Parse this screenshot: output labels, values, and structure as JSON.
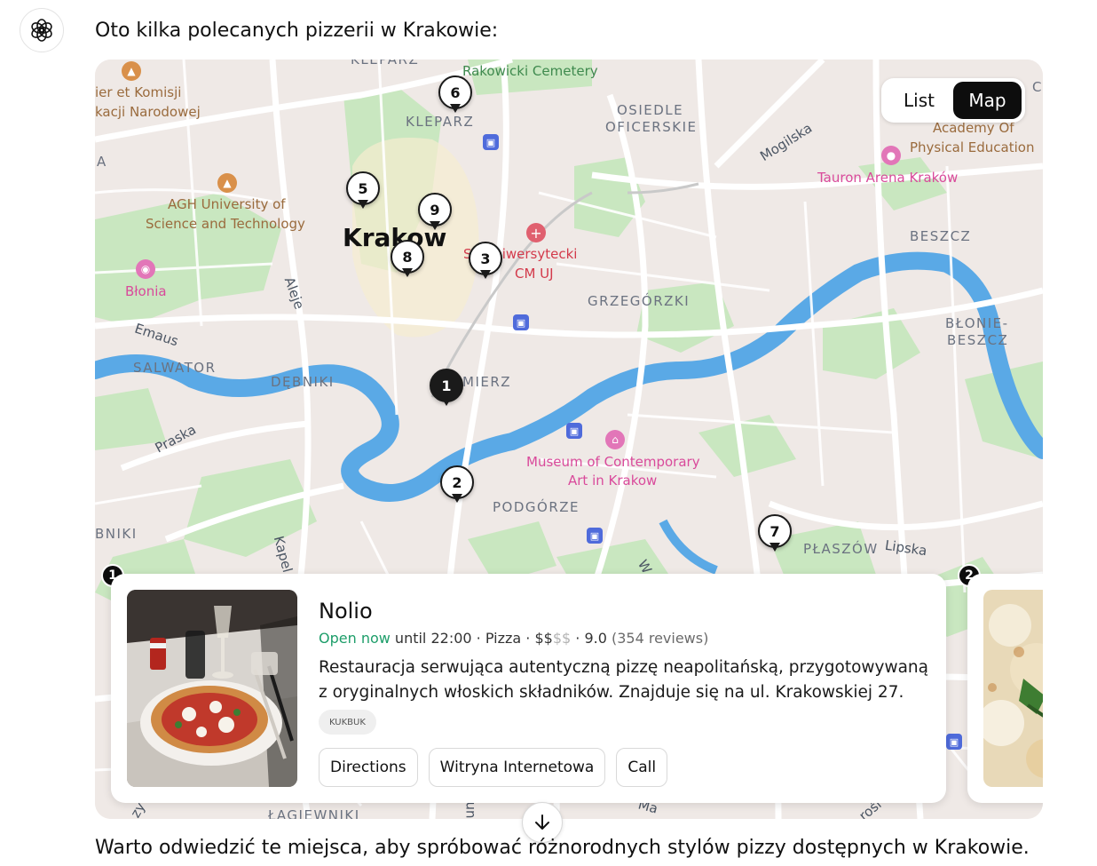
{
  "intro_text": "Oto kilka polecanych pizzerii w Krakowie:",
  "outro_text": "Warto odwiedzić te miejsca, aby spróbować różnorodnych stylów pizzy dostępnych w Krakowie.",
  "view_toggle": {
    "list_label": "List",
    "map_label": "Map",
    "selected": "Map"
  },
  "map": {
    "labels": {
      "kleparz_top": "KLEPARZ",
      "rakowicki": "Rakowicki Cemetery",
      "komisji": "ier  et Komisji",
      "narodowej": "kacji Narodowej",
      "kleparz": "KLEPARZ",
      "osiedle": "OSIEDLE",
      "oficerskie": "OFICERSKIE",
      "mogilska": "Mogilska",
      "academy1": "Academy Of",
      "academy2": "Physical Education",
      "tauron": "Tauron Arena Kraków",
      "agh1": "AGH University of",
      "agh2": "Science and Technology",
      "city": "Krakow",
      "szpital": "S    l Uniwersytecki",
      "cmuj": "CM UJ",
      "beszcz": "BESZCZ",
      "blonia": "Błonia",
      "aleje": "Aleje",
      "grzegorzki": "GRZEGÓRZKI",
      "emaus": "Emaus",
      "bl1": "BŁONIE-",
      "bl2": "BESZCZ",
      "salwator": "SALWATOR",
      "debniki": "DĘBNIKI",
      "kazimierz": "MIERZ",
      "praska": "Praska",
      "museum1": "Museum of Contemporary",
      "museum2": "Art in Krakow",
      "podgorze": "PODGÓRZE",
      "bniki": "BNIKI",
      "kapel": "Kapel",
      "plaszow": "PŁASZÓW",
      "lipska": "Lipska",
      "a_left": "A",
      "c_right": "C",
      "w_road": "W",
      "lagiewniki": "ŁAGIEWNIKI",
      "ma": "Ma",
      "zy": "zy",
      "rosl": "rośl",
      "un": "un"
    },
    "pins": [
      "1",
      "2",
      "3",
      "5",
      "6",
      "7",
      "8",
      "9"
    ]
  },
  "cards": [
    {
      "index_badge": "1",
      "name": "Nolio",
      "open_status": "Open now",
      "hours": " until 22:00",
      "sep1": " · ",
      "category": "Pizza",
      "sep2": " · ",
      "price_active": "$$",
      "price_dim": "$$",
      "sep3": " · ",
      "rating": "9.0",
      "reviews": " (354 reviews)",
      "description": "Restauracja serwująca autentyczną pizzę neapolitańską, przygotowywaną z oryginalnych włoskich składników. Znajduje się na ul. Krakowskiej 27.",
      "source": "KUKBUK",
      "buttons": {
        "directions": "Directions",
        "website": "Witryna Internetowa",
        "call": "Call"
      }
    },
    {
      "index_badge": "2"
    }
  ],
  "colors": {
    "open_green": "#1e9e6a",
    "river": "#5aa9e6",
    "park": "#c8e6c2",
    "accent_dark": "#0d0d0d"
  }
}
